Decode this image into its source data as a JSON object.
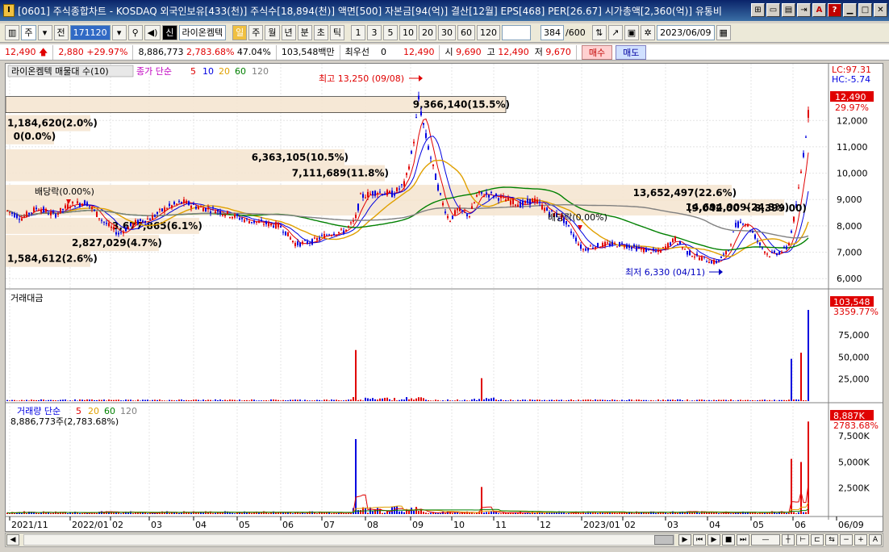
{
  "window": {
    "title": "[0601] 주식종합차트 - KOSDAQ 외국인보유[433(천)] 주식수[18,894(천)] 액면[500] 자본금[94(억)] 결산[12월] EPS[468] PER[26.67] 시가총액[2,360(억)] 유통비",
    "icon_label": "I"
  },
  "toolbar": {
    "type_select": "주",
    "prev_label": "전",
    "code": "171120",
    "stock_name": "라이온켐텍",
    "periods": [
      "일",
      "주",
      "월",
      "년",
      "분",
      "초",
      "틱"
    ],
    "active_period": "일",
    "intervals": [
      "1",
      "3",
      "5",
      "10",
      "20",
      "30",
      "60",
      "120"
    ],
    "count": "384",
    "count_total": "/600",
    "date": "2023/06/09",
    "sin_label": "신"
  },
  "quote": {
    "price": "12,490",
    "change": "2,880",
    "change_pct": "+29.97%",
    "volume": "8,886,773",
    "volume_pct": "2,783.68%",
    "turnover": "47.04%",
    "amount": "103,548백만",
    "label_pref": "최우선",
    "pref_value": "0",
    "pref_price": "12,490",
    "open_label": "시",
    "open": "9,690",
    "high_label": "고",
    "high": "12,490",
    "low_label": "저",
    "low": "9,670",
    "buy_label": "매수",
    "sell_label": "매도"
  },
  "price_panel": {
    "name_tag": "라이온켐텍 매물대 수(10)",
    "ma_label": "종가 단순",
    "ma_periods": [
      "5",
      "10",
      "20",
      "60",
      "120"
    ],
    "ma_colors": [
      "#e00000",
      "#0000e0",
      "#e0a000",
      "#008000",
      "#808080"
    ],
    "lc_label": "LC:97.31",
    "hc_label": "HC:-5.74",
    "current_price_label": "12,490",
    "current_pct_label": "29.97%",
    "high_annotation": "최고 13,250 (09/08)",
    "low_annotation": "최저 6,330 (04/11)",
    "dividend1": "배당락(0.00%)",
    "dividend2": "배당락(0.00%)",
    "range_label": "(9,042.00 ~ 8,399.00)",
    "volume_profile": [
      {
        "label": "9,366,140(15.5%)",
        "level": 12600
      },
      {
        "label": "1,184,620(2.0%)",
        "level": 11900
      },
      {
        "label": "0(0.0%)",
        "level": 11400
      },
      {
        "label": "6,363,105(10.5%)",
        "level": 10600
      },
      {
        "label": "7,111,689(11.8%)",
        "level": 10000
      },
      {
        "label": "13,652,497(22.6%)",
        "level": 9250
      },
      {
        "label": "14,694,909(24.3%)",
        "level": 8700
      },
      {
        "label": "3,677,865(6.1%)",
        "level": 8000
      },
      {
        "label": "2,827,029(4.7%)",
        "level": 7350
      },
      {
        "label": "1,584,612(2.6%)",
        "level": 6750
      }
    ],
    "y_ticks": [
      "12,000",
      "11,000",
      "10,000",
      "9,000",
      "8,000",
      "7,000",
      "6,000"
    ]
  },
  "amount_panel": {
    "name_tag": "거래대금",
    "current_label": "103,548",
    "current_pct": "3359.77%",
    "y_ticks": [
      "75,000",
      "50,000",
      "25,000"
    ]
  },
  "volume_panel": {
    "ma_label": "거래량 단순",
    "ma_periods": [
      "5",
      "20",
      "60",
      "120"
    ],
    "value_label": "8,886,773주(2,783.68%)",
    "current_label": "8,887K",
    "current_pct": "2783.68%",
    "y_ticks": [
      "7,500K",
      "5,000K",
      "2,500K"
    ]
  },
  "x_axis": {
    "labels": [
      "2021/11",
      "2022/01",
      "02",
      "03",
      "04",
      "05",
      "06",
      "07",
      "08",
      "09",
      "10",
      "11",
      "12",
      "2023/01",
      "02",
      "03",
      "04",
      "05",
      "06",
      "06/09"
    ]
  }
}
